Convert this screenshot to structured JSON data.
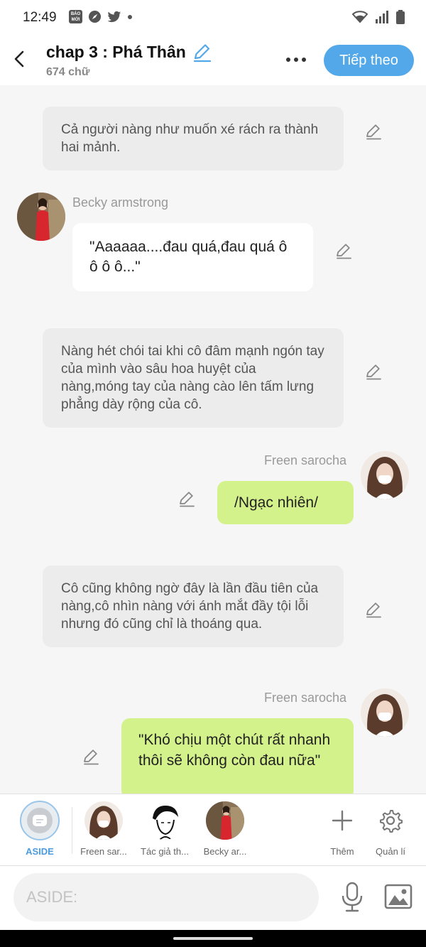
{
  "status_bar": {
    "time": "12:49",
    "badge_text": "BÁO MỚI"
  },
  "header": {
    "title": "chap 3 : Phá Thân",
    "word_count": "674 chữ",
    "next_label": "Tiếp theo"
  },
  "messages": [
    {
      "type": "narration",
      "text": "Cả người nàng như muốn xé rách ra thành hai mảnh."
    },
    {
      "type": "character-left",
      "speaker": "Becky armstrong",
      "text": "\"Aaaaaa....đau quá,đau quá ô ô ô ô...\""
    },
    {
      "type": "narration",
      "text": "Nàng hét chói tai khi cô đâm mạnh ngón tay của mình vào sâu hoa huyệt của nàng,móng tay của nàng cào lên tấm lưng phẳng dày rộng của cô."
    },
    {
      "type": "character-right",
      "speaker": "Freen sarocha",
      "text": "/Ngạc nhiên/"
    },
    {
      "type": "narration",
      "text": "Cô cũng không ngờ đây là lần đầu tiên của nàng,cô nhìn nàng với ánh mắt đầy tội lỗi nhưng đó cũng chỉ là thoáng qua."
    },
    {
      "type": "character-right",
      "speaker": "Freen sarocha",
      "text": "\"Khó chịu một chút rất nhanh thôi sẽ không còn đau nữa\""
    }
  ],
  "character_bar": {
    "aside_label": "ASIDE",
    "characters": [
      {
        "label": "Freen sar..."
      },
      {
        "label": "Tác giả th..."
      },
      {
        "label": "Becky ar..."
      }
    ],
    "add_label": "Thêm",
    "manage_label": "Quản lí"
  },
  "composer": {
    "placeholder": "ASIDE:"
  },
  "colors": {
    "accent": "#52a8e8",
    "right_bubble": "#d4f28c",
    "narration_bg": "#ececec"
  }
}
